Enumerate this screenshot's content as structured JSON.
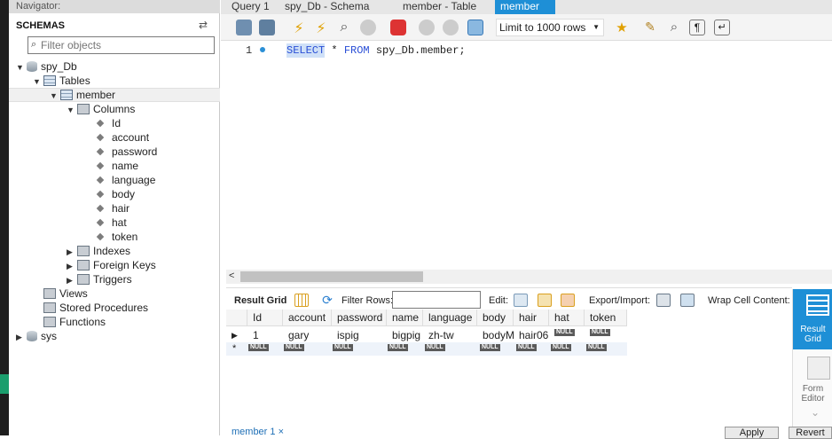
{
  "window": {
    "navigator_title": "Navigator:",
    "schemas_title": "SCHEMAS",
    "filter_placeholder": "Filter objects"
  },
  "tree": {
    "schema": "spy_Db",
    "tables_label": "Tables",
    "table": "member",
    "columns_label": "Columns",
    "columns": [
      "Id",
      "account",
      "password",
      "name",
      "language",
      "body",
      "hair",
      "hat",
      "token"
    ],
    "indexes_label": "Indexes",
    "fks_label": "Foreign Keys",
    "triggers_label": "Triggers",
    "views_label": "Views",
    "procs_label": "Stored Procedures",
    "functions_label": "Functions",
    "other_schema": "sys"
  },
  "tabs": {
    "t1": "Query 1",
    "t2": "spy_Db - Schema",
    "t3": "member - Table",
    "t4": "member",
    "close": "×"
  },
  "toolbar": {
    "limit": "Limit to 1000 rows"
  },
  "editor": {
    "line": "1",
    "kw_select": "SELECT",
    "star": " * ",
    "kw_from": "FROM",
    "rest": " spy_Db.member;"
  },
  "results": {
    "result_grid": "Result Grid",
    "filter_rows": "Filter Rows:",
    "edit": "Edit:",
    "export": "Export/Import:",
    "wrap": "Wrap Cell Content:",
    "headers": [
      "Id",
      "account",
      "password",
      "name",
      "language",
      "body",
      "hair",
      "hat",
      "token"
    ],
    "row": [
      "1",
      "gary",
      "ispig",
      "bigpig",
      "zh-tw",
      "bodyM",
      "hair06",
      "NULL",
      "NULL"
    ],
    "null": "NULL",
    "new_marker": "*"
  },
  "side": {
    "rg1": "Result",
    "rg2": "Grid",
    "fe1": "Form",
    "fe2": "Editor"
  },
  "bottom": {
    "tab": "member 1",
    "apply": "Apply",
    "revert": "Revert"
  }
}
